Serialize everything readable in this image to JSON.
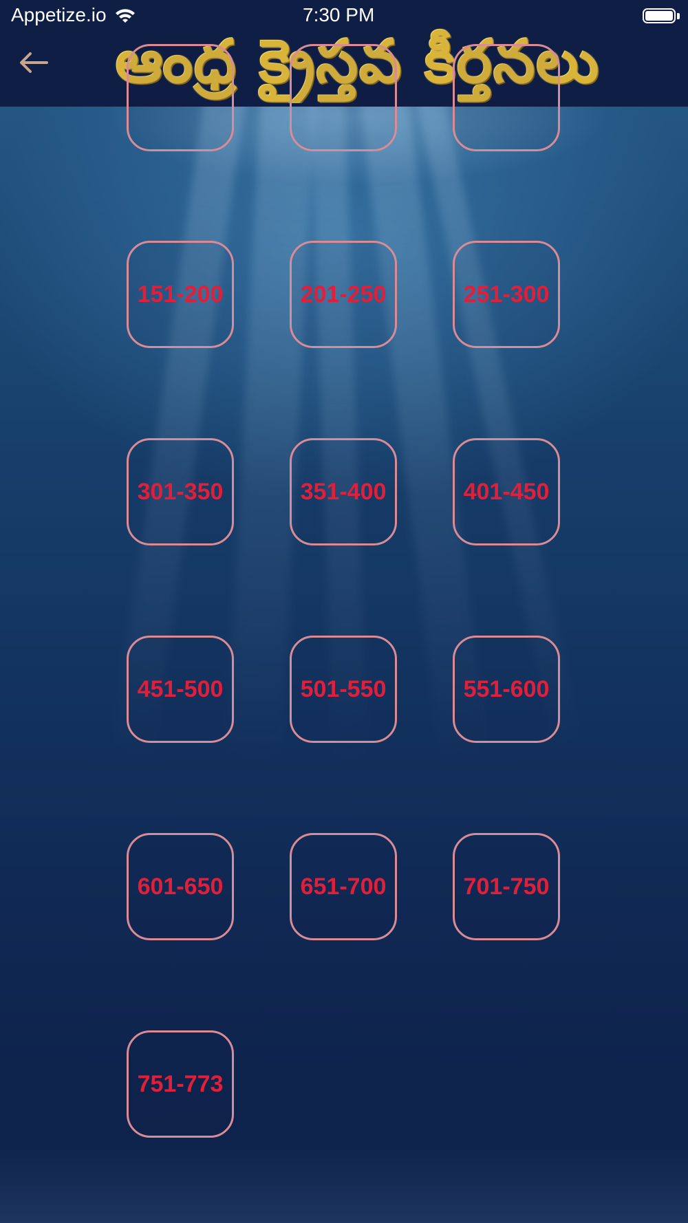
{
  "status_bar": {
    "carrier": "Appetize.io",
    "time": "7:30 PM",
    "wifi_icon": "wifi-icon",
    "battery_icon": "battery-icon"
  },
  "header": {
    "back_icon": "back-arrow-icon",
    "title": "ఆంధ్ర క్రైస్తవ కీర్తనలు",
    "title_color": "#d8b43a",
    "background_color": "#0f1e45"
  },
  "tile_style": {
    "border_color": "#d98c96",
    "text_color": "#e0203a"
  },
  "range_tiles": [
    "",
    "",
    "",
    "151-200",
    "201-250",
    "251-300",
    "301-350",
    "351-400",
    "401-450",
    "451-500",
    "501-550",
    "551-600",
    "601-650",
    "651-700",
    "701-750",
    "751-773"
  ]
}
